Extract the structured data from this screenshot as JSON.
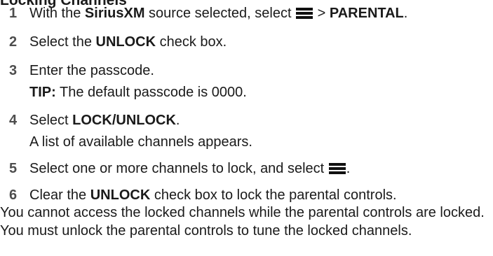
{
  "heading": "Locking Channels",
  "steps": [
    {
      "num": "1",
      "t1": "With the ",
      "b1": "SiriusXM",
      "t2": " source selected, select ",
      "icon": "menu-icon",
      "t3": " > ",
      "b2": "PARENTAL",
      "t4": "."
    },
    {
      "num": "2",
      "t1": "Select the ",
      "b1": "UNLOCK",
      "t2": " check box."
    },
    {
      "num": "3",
      "t1": "Enter the passcode.",
      "tip_label": "TIP:",
      "tip_text": " The default passcode is 0000."
    },
    {
      "num": "4",
      "t1": "Select ",
      "b1": "LOCK/UNLOCK",
      "t2": ".",
      "note": "A list of available channels appears."
    },
    {
      "num": "5",
      "t1": "Select one or more channels to lock, and select ",
      "icon": "menu-icon",
      "t2": "."
    },
    {
      "num": "6",
      "t1": "Clear the ",
      "b1": "UNLOCK",
      "t2": " check box to lock the parental controls."
    }
  ],
  "closing_paragraph": "You cannot access the locked channels while the parental controls are locked. You must unlock the parental controls to tune the locked channels."
}
